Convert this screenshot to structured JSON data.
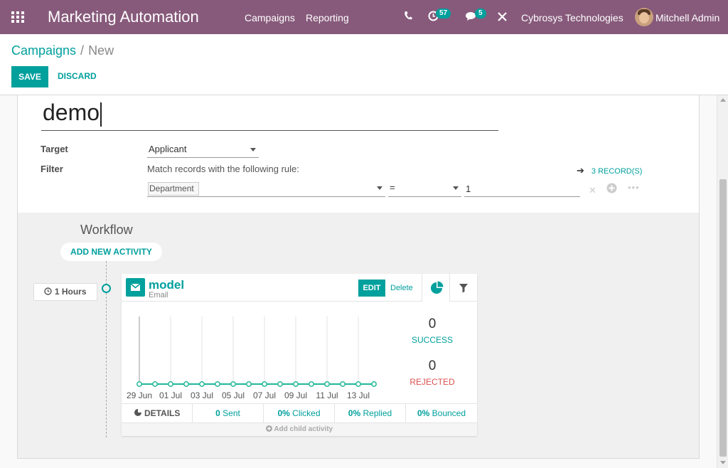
{
  "navbar": {
    "brand": "Marketing Automation",
    "menu": [
      "Campaigns",
      "Reporting"
    ],
    "activity_badge": "57",
    "messages_badge": "5",
    "company": "Cybrosys Technologies",
    "user": "Mitchell Admin",
    "bg_color": "#875a7b"
  },
  "breadcrumb": {
    "parent": "Campaigns",
    "separator": "/",
    "current": "New"
  },
  "actions": {
    "save": "SAVE",
    "discard": "DISCARD"
  },
  "form": {
    "name": "demo",
    "target_label": "Target",
    "target_value": "Applicant",
    "filter_label": "Filter",
    "rule_text": "Match records with the following rule:",
    "records": "3 RECORD(S)",
    "rule": {
      "field": "Department",
      "operator": "=",
      "value": "1"
    }
  },
  "workflow": {
    "title": "Workflow",
    "add_activity": "ADD NEW ACTIVITY",
    "interval": "1 Hours",
    "activity": {
      "name": "model",
      "type": "Email",
      "edit": "EDIT",
      "delete": "Delete",
      "success_count": "0",
      "success_label": "SUCCESS",
      "rejected_count": "0",
      "rejected_label": "REJECTED",
      "footer": {
        "details": "DETAILS",
        "sent_num": "0",
        "sent_label": "Sent",
        "clicked_num": "0%",
        "clicked_label": "Clicked",
        "replied_num": "0%",
        "replied_label": "Replied",
        "bounced_num": "0%",
        "bounced_label": "Bounced"
      },
      "add_child": "Add child activity"
    }
  },
  "chart_data": {
    "type": "line",
    "x": [
      "29 Jun",
      "30 Jun",
      "01 Jul",
      "02 Jul",
      "03 Jul",
      "04 Jul",
      "05 Jul",
      "06 Jul",
      "07 Jul",
      "08 Jul",
      "09 Jul",
      "10 Jul",
      "11 Jul",
      "12 Jul",
      "13 Jul",
      "14 Jul"
    ],
    "tick_labels": [
      "29 Jun",
      "01 Jul",
      "03 Jul",
      "05 Jul",
      "07 Jul",
      "09 Jul",
      "11 Jul",
      "13 Jul"
    ],
    "series": [
      {
        "values": [
          0,
          0,
          0,
          0,
          0,
          0,
          0,
          0,
          0,
          0,
          0,
          0,
          0,
          0,
          0,
          0
        ],
        "color": "#21b799"
      }
    ],
    "grid": "vertical"
  },
  "colors": {
    "accent": "#00a09d",
    "success": "#00a09d",
    "rejected": "#d9534f"
  }
}
